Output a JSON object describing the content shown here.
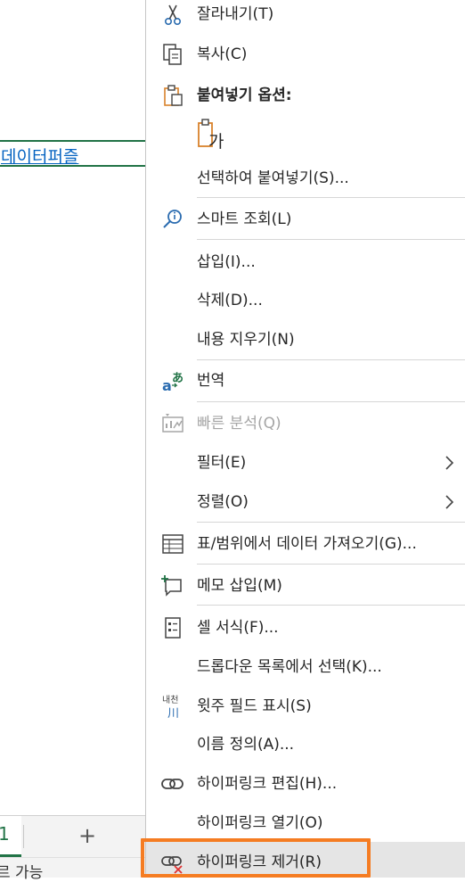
{
  "sheet": {
    "link_cell_text": "데이터퍼즐",
    "active_tab_text": "1",
    "add_sheet": "+",
    "status_text": "르 가능"
  },
  "menu": {
    "cut": "잘라내기(T)",
    "copy": "복사(C)",
    "paste_options": "붙여넣기 옵션:",
    "paste_special": "선택하여 붙여넣기(S)...",
    "smart_lookup": "스마트 조회(L)",
    "insert": "삽입(I)...",
    "delete": "삭제(D)...",
    "clear_contents": "내용 지우기(N)",
    "translate": "번역",
    "quick_analysis": "빠른 분석(Q)",
    "filter": "필터(E)",
    "sort": "정렬(O)",
    "get_data": "표/범위에서 데이터 가져오기(G)...",
    "insert_note": "메모 삽입(M)",
    "format_cells": "셀 서식(F)...",
    "pick_dropdown": "드롭다운 목록에서 선택(K)...",
    "phonetic": "윗주 필드 표시(S)",
    "define_name": "이름 정의(A)...",
    "edit_hyperlink": "하이퍼링크 편집(H)...",
    "open_hyperlink": "하이퍼링크 열기(O)",
    "remove_hyperlink": "하이퍼링크 제거(R)",
    "paste_glyph": "가",
    "phonetic_glyph_top": "내천",
    "phonetic_glyph_bottom": "川"
  },
  "colors": {
    "accent": "#217346",
    "link": "#0563c1",
    "highlight_border": "#f57c22",
    "hover": "#e5e5e5",
    "icon_blue": "#2b6cb0",
    "icon_orange": "#d9822b"
  }
}
